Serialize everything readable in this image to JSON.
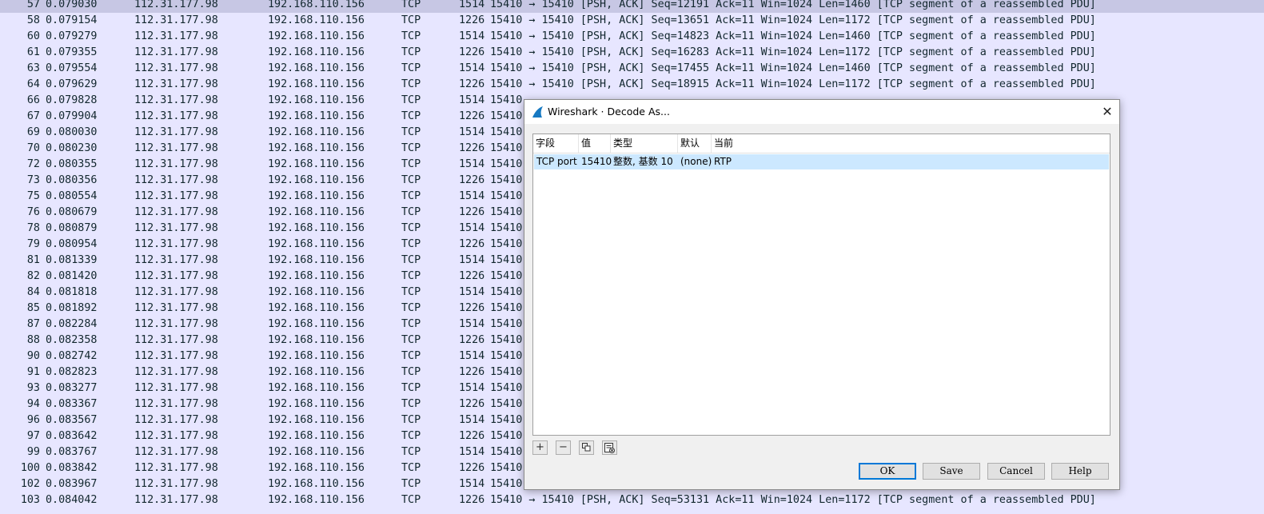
{
  "packets": [
    {
      "no": "57",
      "time": "0.079030",
      "src": "112.31.177.98",
      "dst": "192.168.110.156",
      "proto": "TCP",
      "len": "1514",
      "info": "15410 → 15410 [PSH, ACK] Seq=12191 Ack=11 Win=1024 Len=1460 [TCP segment of a reassembled PDU]",
      "selected": true
    },
    {
      "no": "58",
      "time": "0.079154",
      "src": "112.31.177.98",
      "dst": "192.168.110.156",
      "proto": "TCP",
      "len": "1226",
      "info": "15410 → 15410 [PSH, ACK] Seq=13651 Ack=11 Win=1024 Len=1172 [TCP segment of a reassembled PDU]"
    },
    {
      "no": "60",
      "time": "0.079279",
      "src": "112.31.177.98",
      "dst": "192.168.110.156",
      "proto": "TCP",
      "len": "1514",
      "info": "15410 → 15410 [PSH, ACK] Seq=14823 Ack=11 Win=1024 Len=1460 [TCP segment of a reassembled PDU]"
    },
    {
      "no": "61",
      "time": "0.079355",
      "src": "112.31.177.98",
      "dst": "192.168.110.156",
      "proto": "TCP",
      "len": "1226",
      "info": "15410 → 15410 [PSH, ACK] Seq=16283 Ack=11 Win=1024 Len=1172 [TCP segment of a reassembled PDU]"
    },
    {
      "no": "63",
      "time": "0.079554",
      "src": "112.31.177.98",
      "dst": "192.168.110.156",
      "proto": "TCP",
      "len": "1514",
      "info": "15410 → 15410 [PSH, ACK] Seq=17455 Ack=11 Win=1024 Len=1460 [TCP segment of a reassembled PDU]"
    },
    {
      "no": "64",
      "time": "0.079629",
      "src": "112.31.177.98",
      "dst": "192.168.110.156",
      "proto": "TCP",
      "len": "1226",
      "info": "15410 → 15410 [PSH, ACK] Seq=18915 Ack=11 Win=1024 Len=1172 [TCP segment of a reassembled PDU]"
    },
    {
      "no": "66",
      "time": "0.079828",
      "src": "112.31.177.98",
      "dst": "192.168.110.156",
      "proto": "TCP",
      "len": "1514",
      "info": "15410"
    },
    {
      "no": "67",
      "time": "0.079904",
      "src": "112.31.177.98",
      "dst": "192.168.110.156",
      "proto": "TCP",
      "len": "1226",
      "info": "15410"
    },
    {
      "no": "69",
      "time": "0.080030",
      "src": "112.31.177.98",
      "dst": "192.168.110.156",
      "proto": "TCP",
      "len": "1514",
      "info": "15410"
    },
    {
      "no": "70",
      "time": "0.080230",
      "src": "112.31.177.98",
      "dst": "192.168.110.156",
      "proto": "TCP",
      "len": "1226",
      "info": "15410"
    },
    {
      "no": "72",
      "time": "0.080355",
      "src": "112.31.177.98",
      "dst": "192.168.110.156",
      "proto": "TCP",
      "len": "1514",
      "info": "15410"
    },
    {
      "no": "73",
      "time": "0.080356",
      "src": "112.31.177.98",
      "dst": "192.168.110.156",
      "proto": "TCP",
      "len": "1226",
      "info": "15410"
    },
    {
      "no": "75",
      "time": "0.080554",
      "src": "112.31.177.98",
      "dst": "192.168.110.156",
      "proto": "TCP",
      "len": "1514",
      "info": "15410"
    },
    {
      "no": "76",
      "time": "0.080679",
      "src": "112.31.177.98",
      "dst": "192.168.110.156",
      "proto": "TCP",
      "len": "1226",
      "info": "15410"
    },
    {
      "no": "78",
      "time": "0.080879",
      "src": "112.31.177.98",
      "dst": "192.168.110.156",
      "proto": "TCP",
      "len": "1514",
      "info": "15410"
    },
    {
      "no": "79",
      "time": "0.080954",
      "src": "112.31.177.98",
      "dst": "192.168.110.156",
      "proto": "TCP",
      "len": "1226",
      "info": "15410"
    },
    {
      "no": "81",
      "time": "0.081339",
      "src": "112.31.177.98",
      "dst": "192.168.110.156",
      "proto": "TCP",
      "len": "1514",
      "info": "15410"
    },
    {
      "no": "82",
      "time": "0.081420",
      "src": "112.31.177.98",
      "dst": "192.168.110.156",
      "proto": "TCP",
      "len": "1226",
      "info": "15410"
    },
    {
      "no": "84",
      "time": "0.081818",
      "src": "112.31.177.98",
      "dst": "192.168.110.156",
      "proto": "TCP",
      "len": "1514",
      "info": "15410"
    },
    {
      "no": "85",
      "time": "0.081892",
      "src": "112.31.177.98",
      "dst": "192.168.110.156",
      "proto": "TCP",
      "len": "1226",
      "info": "15410"
    },
    {
      "no": "87",
      "time": "0.082284",
      "src": "112.31.177.98",
      "dst": "192.168.110.156",
      "proto": "TCP",
      "len": "1514",
      "info": "15410"
    },
    {
      "no": "88",
      "time": "0.082358",
      "src": "112.31.177.98",
      "dst": "192.168.110.156",
      "proto": "TCP",
      "len": "1226",
      "info": "15410"
    },
    {
      "no": "90",
      "time": "0.082742",
      "src": "112.31.177.98",
      "dst": "192.168.110.156",
      "proto": "TCP",
      "len": "1514",
      "info": "15410"
    },
    {
      "no": "91",
      "time": "0.082823",
      "src": "112.31.177.98",
      "dst": "192.168.110.156",
      "proto": "TCP",
      "len": "1226",
      "info": "15410"
    },
    {
      "no": "93",
      "time": "0.083277",
      "src": "112.31.177.98",
      "dst": "192.168.110.156",
      "proto": "TCP",
      "len": "1514",
      "info": "15410"
    },
    {
      "no": "94",
      "time": "0.083367",
      "src": "112.31.177.98",
      "dst": "192.168.110.156",
      "proto": "TCP",
      "len": "1226",
      "info": "15410"
    },
    {
      "no": "96",
      "time": "0.083567",
      "src": "112.31.177.98",
      "dst": "192.168.110.156",
      "proto": "TCP",
      "len": "1514",
      "info": "15410"
    },
    {
      "no": "97",
      "time": "0.083642",
      "src": "112.31.177.98",
      "dst": "192.168.110.156",
      "proto": "TCP",
      "len": "1226",
      "info": "15410"
    },
    {
      "no": "99",
      "time": "0.083767",
      "src": "112.31.177.98",
      "dst": "192.168.110.156",
      "proto": "TCP",
      "len": "1514",
      "info": "15410"
    },
    {
      "no": "100",
      "time": "0.083842",
      "src": "112.31.177.98",
      "dst": "192.168.110.156",
      "proto": "TCP",
      "len": "1226",
      "info": "15410"
    },
    {
      "no": "102",
      "time": "0.083967",
      "src": "112.31.177.98",
      "dst": "192.168.110.156",
      "proto": "TCP",
      "len": "1514",
      "info": "15410"
    },
    {
      "no": "103",
      "time": "0.084042",
      "src": "112.31.177.98",
      "dst": "192.168.110.156",
      "proto": "TCP",
      "len": "1226",
      "info": "15410 → 15410 [PSH, ACK] Seq=53131 Ack=11 Win=1024 Len=1172 [TCP segment of a reassembled PDU]"
    }
  ],
  "dialog": {
    "title": "Wireshark · Decode As...",
    "icon": "wireshark-fin-icon",
    "close_glyph": "✕",
    "columns": {
      "field": "字段",
      "value": "值",
      "type": "类型",
      "default": "默认",
      "current": "当前"
    },
    "row": {
      "field": "TCP port",
      "value": "15410",
      "type": "整数, 基数 10",
      "default": "(none)",
      "current": "RTP"
    },
    "buttons": {
      "ok": "OK",
      "save": "Save",
      "cancel": "Cancel",
      "help": "Help"
    },
    "toolbar": {
      "add": "+",
      "remove": "−"
    }
  },
  "colors": {
    "list_bg": "#e7e6ff",
    "selected_bg": "#c7c7e4",
    "table_row_selected": "#cce8ff",
    "accent": "#0078d7"
  }
}
